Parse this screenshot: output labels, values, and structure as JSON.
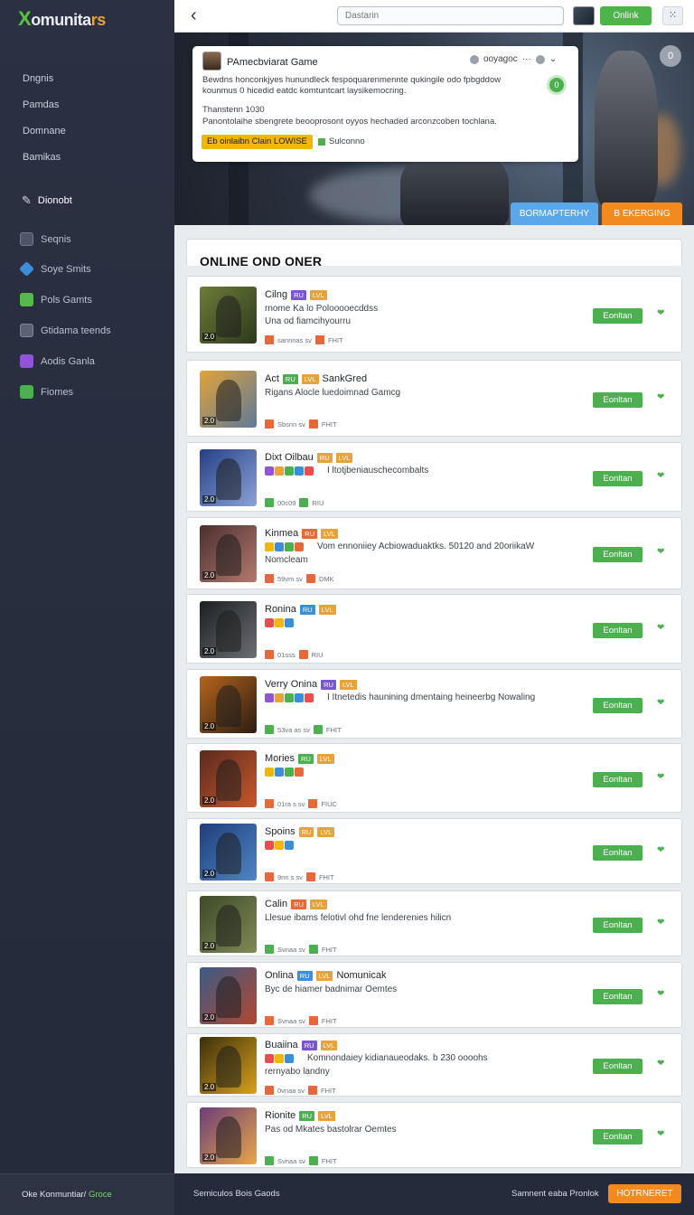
{
  "app": {
    "logo_x": "X",
    "logo_mid": "omunita",
    "logo_end": "rs"
  },
  "sidebar": {
    "links": [
      "Dngnis",
      "Pamdas",
      "Domnane",
      "Bamikas"
    ],
    "section": "Dionobt",
    "items": [
      {
        "label": "Seqnis",
        "color": "#4d5567"
      },
      {
        "label": "Soye Smits",
        "color": "#3b8fd9"
      },
      {
        "label": "Pols Gamts",
        "color": "#57b94a"
      },
      {
        "label": "Gtidama teends",
        "color": "#5b6274"
      },
      {
        "label": "Aodis Ganla",
        "color": "#8f55d6"
      },
      {
        "label": "Fiomes",
        "color": "#4caf50"
      }
    ]
  },
  "topbar": {
    "search_placeholder": "Dastarin",
    "online_label": "Onlink",
    "grid_icon": "grid-icon"
  },
  "hero": {
    "card_title": "PAmecbviarat Game",
    "meta_text": "ooyagoc",
    "green_label": "0",
    "description": "Bewdns honconkjyes hunundleck fespoquarenmennte qukingile odo fpbgddow kounmus 0 hicedid eatdc komtuntcart laysikemocring.",
    "sub1": "Thanstenn 1030",
    "sub2": "Panontolaihe sbengrete beooprosont oyyos hechaded arconzcoben tochlana.",
    "tag": "Eb oinlaibn Clain LOWISE",
    "status": "Sulconno",
    "circle_label": "0",
    "btn_primary": "BORMAPTERHY",
    "btn_secondary": "B EKERGING"
  },
  "main": {
    "section_title": "ONLINE OND ONER",
    "cards": [
      {
        "title": "Cilng",
        "line1": "rnome Ka lo Polooooecddss",
        "line2": "Una od fiamcihyourru",
        "meta": "sannnas sv",
        "meta2": "FHIT",
        "btn": "Eonltan",
        "thumb": [
          "#6e7b3a",
          "#2d3a1c"
        ]
      },
      {
        "title": "Act",
        "title2": "SankGred",
        "line1": "Rigans Alocle luedoimnad Gamcg",
        "meta": "Sbsnn sv",
        "meta2": "FHIT",
        "btn": "Eonltan",
        "thumb": [
          "#e0a33a",
          "#5e7a98"
        ]
      },
      {
        "title": "Dixt Oilbau",
        "line1": "I ltotjbeniauschecombalts",
        "meta": "00c09",
        "meta2": "RIU",
        "btn": "Eonltan",
        "thumb": [
          "#253f86",
          "#8ca3d7"
        ]
      },
      {
        "title": "Kinmea",
        "line1": "Vom ennoniiey Acbiowaduaktks. 50120 and 20oriikaW",
        "line2": "Nomcleam",
        "meta": "59vm sv",
        "meta2": "DMK",
        "btn": "Eonltan",
        "thumb": [
          "#4a2f2f",
          "#b57a6e"
        ]
      },
      {
        "title": "Ronina",
        "meta": "01sss",
        "meta2": "RIU",
        "btn": "Eonltan",
        "thumb": [
          "#1c1f22",
          "#6b6f74"
        ]
      },
      {
        "title": "Verry Onina",
        "line1": "I Itnetedis haunining dmentaing heineerbg Nowaling",
        "meta": "53va as sv",
        "meta2": "FHIT",
        "btn": "Eonltan",
        "thumb": [
          "#b5651d",
          "#2b1d13"
        ]
      },
      {
        "title": "Mories",
        "meta": "01ra s sv",
        "meta2": "FIUC",
        "btn": "Eonltan",
        "thumb": [
          "#5a2a1e",
          "#c9582b"
        ]
      },
      {
        "title": "Spoins",
        "meta": "9nn s sv",
        "meta2": "FHIT",
        "btn": "Eonltan",
        "thumb": [
          "#1f3e7a",
          "#4f86c6"
        ]
      },
      {
        "title": "Calin",
        "line1": "Llesue ibams felotivl ohd fne lenderenies hilicn",
        "meta": "Svnaa sv",
        "meta2": "FHIT",
        "btn": "Eonltan",
        "thumb": [
          "#3e4a2a",
          "#7e8a53"
        ]
      },
      {
        "title": "Onlina",
        "title2": "Nomunicak",
        "line1": "Byc de hiamer badnimar Oemtes",
        "meta": "Svnaa sv",
        "meta2": "FHIT",
        "btn": "Eonltan",
        "thumb": [
          "#3a5b86",
          "#b3472f"
        ]
      },
      {
        "title": "Buaiina",
        "line1": "Komnondaiey kidianaueodaks. b 230 oooohs",
        "line2": "rernyabo landny",
        "meta": "0vnaa sv",
        "meta2": "FHIT",
        "btn": "Eonltan",
        "thumb": [
          "#3a2e0c",
          "#d9a11d"
        ]
      },
      {
        "title": "Rionite",
        "line1": "Pas od Mkates bastolrar Oemtes",
        "meta": "Svnaa sv",
        "meta2": "FHIT",
        "btn": "Eonltan",
        "thumb": [
          "#6b3d78",
          "#e9a64a"
        ]
      }
    ]
  },
  "footer": {
    "left": "Oke Konmuntiar/",
    "left_accent": "Groce",
    "center": "Semiculos Bois Gaods",
    "right": "Samnent eaba Pronlok",
    "button": "HOTRNERET"
  }
}
